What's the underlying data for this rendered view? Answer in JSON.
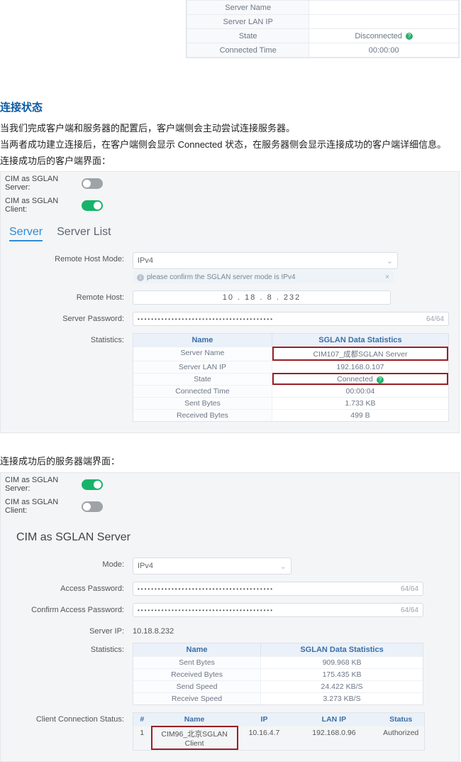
{
  "top_partial": {
    "rows": [
      {
        "label": "Server Name",
        "value": ""
      },
      {
        "label": "Server LAN IP",
        "value": ""
      },
      {
        "label": "State",
        "value": "Disconnected",
        "has_q": true
      },
      {
        "label": "Connected Time",
        "value": "00:00:00"
      }
    ]
  },
  "section1": {
    "title": "连接状态",
    "p1": "当我们完成客户端和服务器的配置后，客户端侧会主动尝试连接服务器。",
    "p2": "当两者成功建立连接后，在客户端侧会显示 Connected 状态，在服务器侧会显示连接成功的客户端详细信息。",
    "p3": "连接成功后的客户端界面："
  },
  "client_panel": {
    "toggle_server_label": "CIM as SGLAN Server:",
    "toggle_client_label": "CIM as SGLAN Client:",
    "tabs": {
      "server": "Server",
      "server_list": "Server List"
    },
    "remote_host_mode_label": "Remote Host Mode:",
    "remote_host_mode_value": "IPv4",
    "hint_text": "please confirm the SGLAN server mode is IPv4",
    "remote_host_label": "Remote Host:",
    "remote_host_value": "10 . 18 . 8 . 232",
    "server_password_label": "Server Password:",
    "pw_mask": "••••••••••••••••••••••••••••••••••••••••",
    "pw_counter": "64/64",
    "statistics_label": "Statistics:",
    "stats_head_name": "Name",
    "stats_head_data": "SGLAN Data Statistics",
    "stats_rows": [
      {
        "label": "Server Name",
        "value": "CIM107_成都SGLAN Server",
        "hl": true
      },
      {
        "label": "Server LAN IP",
        "value": "192.168.0.107"
      },
      {
        "label": "State",
        "value": "Connected",
        "has_q": true,
        "hl": true
      },
      {
        "label": "Connected Time",
        "value": "00:00:04"
      },
      {
        "label": "Sent Bytes",
        "value": "1.733 KB"
      },
      {
        "label": "Received Bytes",
        "value": "499 B"
      }
    ]
  },
  "section2": {
    "p1": "连接成功后的服务器端界面："
  },
  "server_panel": {
    "toggle_server_label": "CIM as SGLAN Server:",
    "toggle_client_label": "CIM as SGLAN Client:",
    "title": "CIM as SGLAN Server",
    "mode_label": "Mode:",
    "mode_value": "IPv4",
    "access_pw_label": "Access Password:",
    "confirm_pw_label": "Confirm Access Password:",
    "pw_mask": "••••••••••••••••••••••••••••••••••••••••",
    "pw_counter": "64/64",
    "server_ip_label": "Server IP:",
    "server_ip_value": "10.18.8.232",
    "statistics_label": "Statistics:",
    "stats_head_name": "Name",
    "stats_head_data": "SGLAN Data Statistics",
    "stats_rows": [
      {
        "label": "Sent Bytes",
        "value": "909.968 KB"
      },
      {
        "label": "Received Bytes",
        "value": "175.435 KB"
      },
      {
        "label": "Send Speed",
        "value": "24.422 KB/S"
      },
      {
        "label": "Receive Speed",
        "value": "3.273 KB/S"
      }
    ],
    "ccs_label": "Client Connection Status:",
    "ccs_head": {
      "num": "#",
      "name": "Name",
      "ip": "IP",
      "lan": "LAN IP",
      "status": "Status"
    },
    "ccs_row": {
      "num": "1",
      "name": "CIM96_北京SGLAN Client",
      "ip": "10.16.4.7",
      "lan": "192.168.0.96",
      "status": "Authorized"
    }
  }
}
